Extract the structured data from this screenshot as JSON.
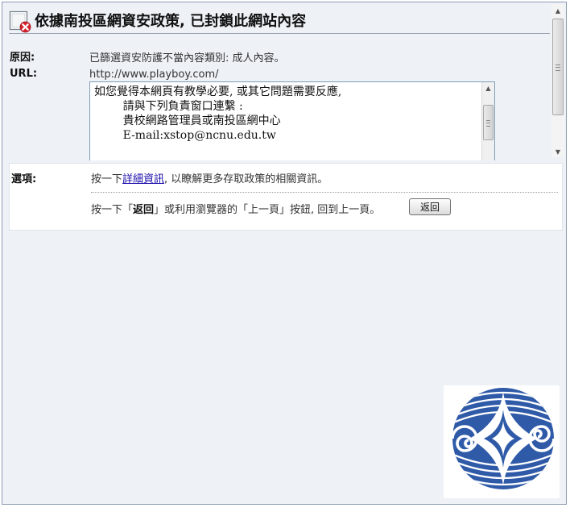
{
  "header": {
    "title": "依據南投區網資安政策, 已封鎖此網站內容",
    "icon": "blocked-page-icon"
  },
  "details": {
    "reason_label": "原因:",
    "reason_value": "已篩選資安防護不當內容類別: 成人內容。",
    "url_label": "URL:",
    "url_value": "http://www.playboy.com/"
  },
  "message_box": {
    "lines": [
      "如您覺得本網頁有教學必要, 或其它問題需要反應,",
      "        請與下列負責窗口連繫 :",
      "        貴校網路管理員或南投區網中心",
      "        E-mail:xstop@ncnu.edu.tw"
    ]
  },
  "options": {
    "label": "選項:",
    "line1_prefix": "按一下",
    "line1_link": "詳細資訊",
    "line1_suffix": ", 以瞭解更多存取政策的相關資訊。",
    "line2_prefix": "按一下「",
    "line2_bold": "返回",
    "line2_suffix": "」或利用瀏覽器的「上一頁」按鈕, 回到上一頁。",
    "back_button_label": "返回"
  },
  "logo": {
    "icon": "ncnu-emblem-icon",
    "colors": {
      "primary": "#2f5aa8",
      "background": "#ffffff"
    }
  }
}
